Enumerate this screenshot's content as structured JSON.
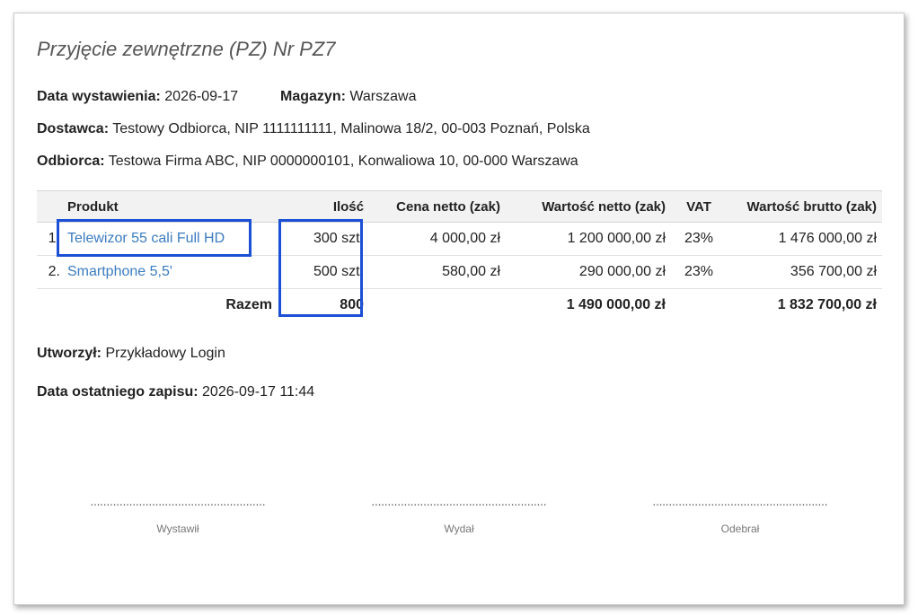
{
  "document": {
    "title": "Przyjęcie zewnętrzne (PZ) Nr PZ7",
    "issue_date_label": "Data wystawienia:",
    "issue_date": "2026-09-17",
    "warehouse_label": "Magazyn:",
    "warehouse": "Warszawa",
    "supplier_label": "Dostawca:",
    "supplier": "Testowy Odbiorca, NIP 1111111111, Malinowa 18/2, 00-003 Poznań, Polska",
    "recipient_label": "Odbiorca:",
    "recipient": "Testowa Firma ABC, NIP 0000000101, Konwaliowa 10, 00-000 Warszawa"
  },
  "table": {
    "headers": {
      "product": "Produkt",
      "qty": "Ilość",
      "net_price": "Cena netto (zak)",
      "net_value": "Wartość netto (zak)",
      "vat": "VAT",
      "gross_value": "Wartość brutto (zak)"
    },
    "rows": [
      {
        "no": "1.",
        "product": "Telewizor 55 cali Full HD",
        "qty": "300 szt.",
        "net_price": "4 000,00 zł",
        "net_value": "1 200 000,00 zł",
        "vat": "23%",
        "gross_value": "1 476 000,00 zł"
      },
      {
        "no": "2.",
        "product": "Smartphone 5,5'",
        "qty": "500 szt.",
        "net_price": "580,00 zł",
        "net_value": "290 000,00 zł",
        "vat": "23%",
        "gross_value": "356 700,00 zł"
      }
    ],
    "total": {
      "label": "Razem",
      "qty": "800",
      "net_value": "1 490 000,00 zł",
      "gross_value": "1 832 700,00 zł"
    }
  },
  "footer": {
    "created_by_label": "Utworzył:",
    "created_by": "Przykładowy Login",
    "last_saved_label": "Data ostatniego zapisu:",
    "last_saved": "2026-09-17 11:44"
  },
  "signatures": {
    "dots": "......................................................",
    "issued": "Wystawił",
    "released": "Wydał",
    "received": "Odebrał"
  },
  "colors": {
    "highlight": "#1a4fd6",
    "link": "#3a7bbf"
  }
}
